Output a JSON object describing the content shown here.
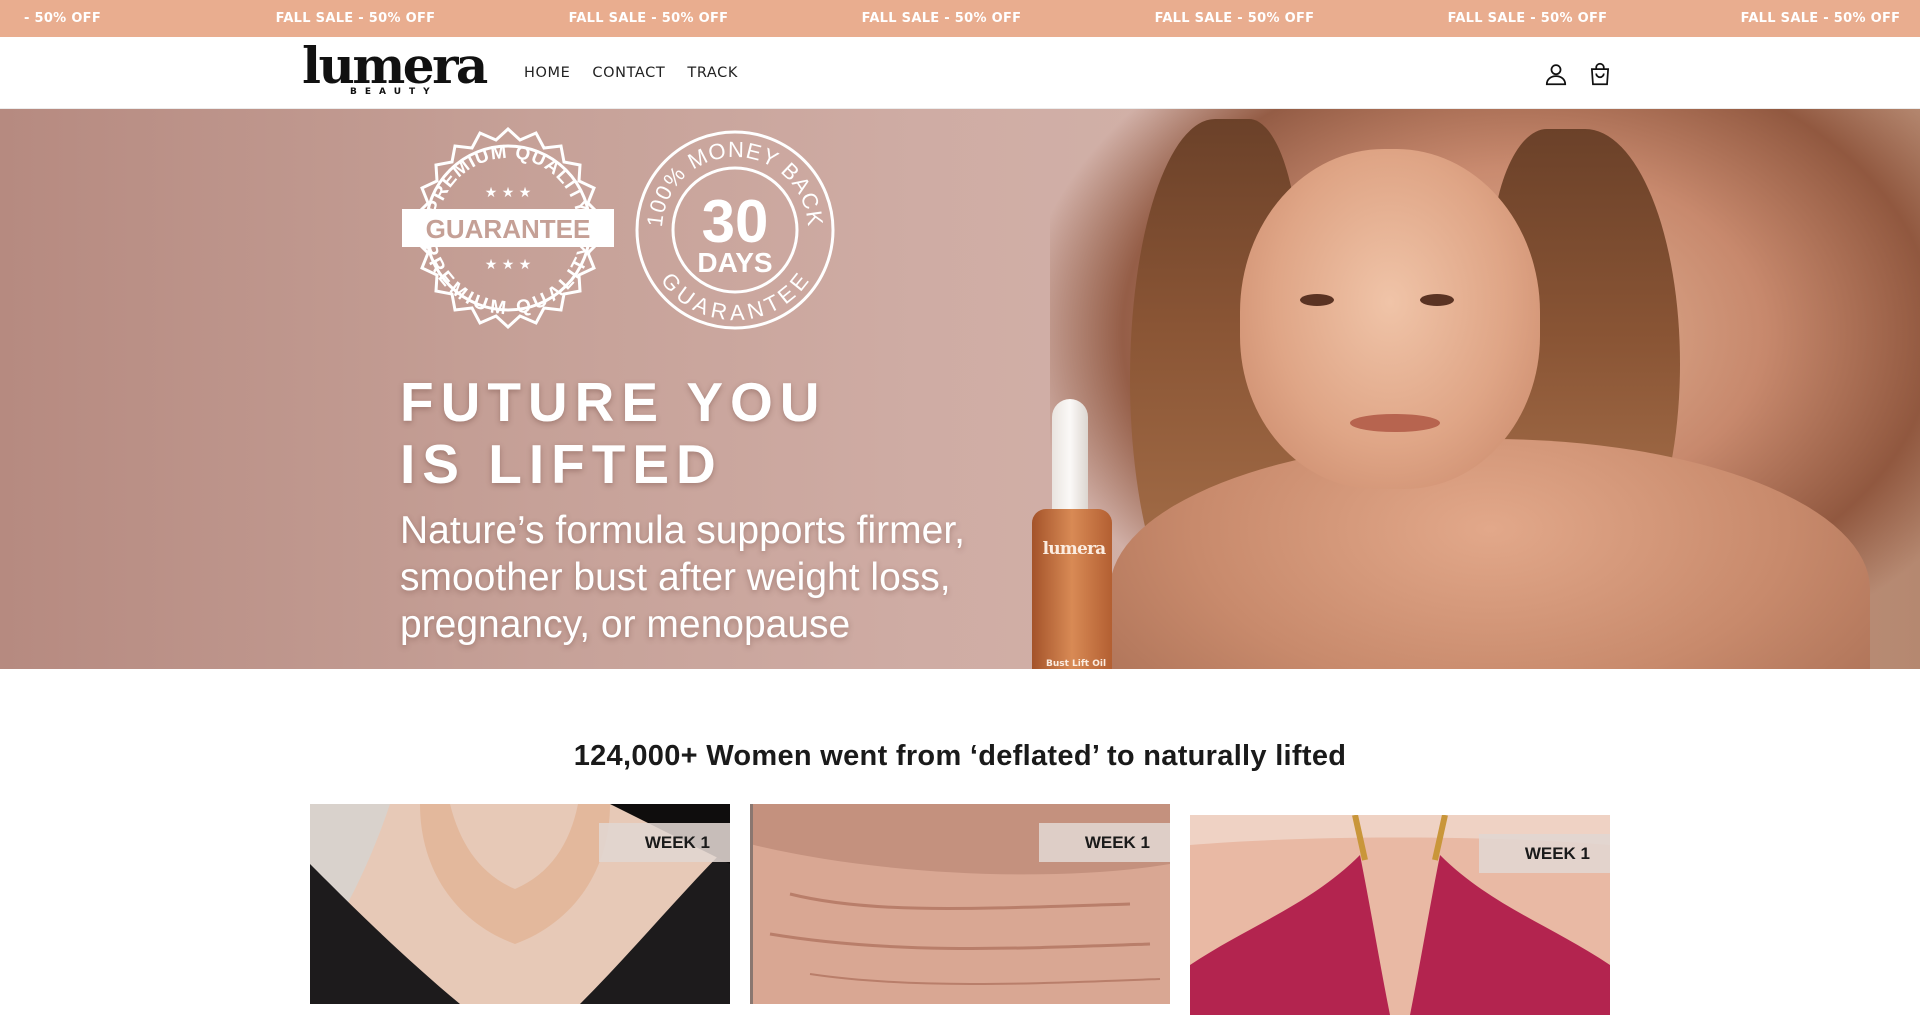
{
  "announcement": {
    "items": [
      "- 50% OFF",
      "FALL SALE - 50% OFF",
      "FALL SALE - 50% OFF",
      "FALL SALE - 50% OFF",
      "FALL SALE - 50% OFF",
      "FALL SALE - 50% OFF",
      "FALL SALE - 50% OFF"
    ],
    "background": "#e9ad8f"
  },
  "header": {
    "logo_word": "lumera",
    "logo_sub": "BEAUTY",
    "nav": [
      "HOME",
      "CONTACT",
      "TRACK"
    ],
    "icons": [
      "account-icon",
      "cart-icon"
    ]
  },
  "hero": {
    "badge_quality": {
      "top_arc": "PREMIUM QUALITY",
      "center": "GUARANTEE",
      "bottom_arc": "PREMIUM QUALITY"
    },
    "badge_money": {
      "arc_top": "100% MONEY BACK",
      "number": "30",
      "unit": "DAYS",
      "arc_bottom": "GUARANTEE"
    },
    "title_line1": "FUTURE YOU",
    "title_line2": "IS LIFTED",
    "subtitle": "Nature’s formula supports firmer, smoother bust after weight loss, pregnancy, or menopause",
    "bottle_logo": "lumera",
    "bottle_label": "Bust Lift Oil"
  },
  "testimonials": {
    "title": "124,000+ Women went from ‘deflated’ to naturally lifted",
    "cards": [
      {
        "label": "WEEK 1"
      },
      {
        "label": "WEEK 1"
      },
      {
        "label": "WEEK 1"
      }
    ]
  }
}
